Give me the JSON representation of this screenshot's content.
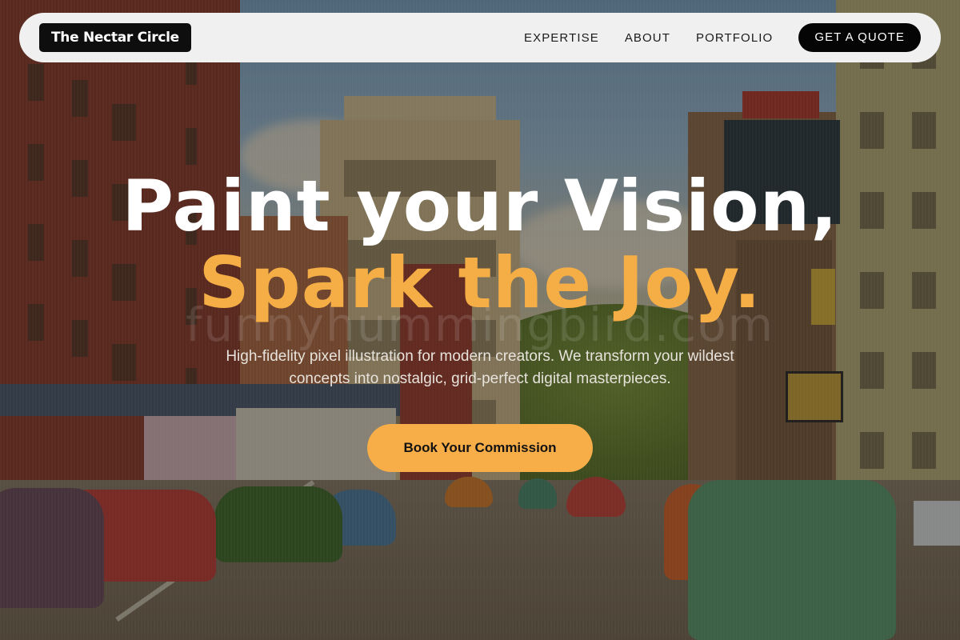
{
  "nav": {
    "brand": "The Nectar Circle",
    "links": [
      "EXPERTISE",
      "ABOUT",
      "PORTFOLIO"
    ],
    "cta": "GET A QUOTE"
  },
  "hero": {
    "headline_line1": "Paint your Vision,",
    "headline_line2": "Spark the Joy.",
    "subtitle": "High-fidelity pixel illustration for modern creators. We transform your wildest concepts into nostalgic, grid-perfect digital masterpieces.",
    "cta": "Book Your Commission"
  },
  "watermark": "funnyhummingbird.com",
  "colors": {
    "accent": "#f5ad45",
    "nav_bg": "#f0f0f1",
    "dark": "#0e0e0e"
  }
}
